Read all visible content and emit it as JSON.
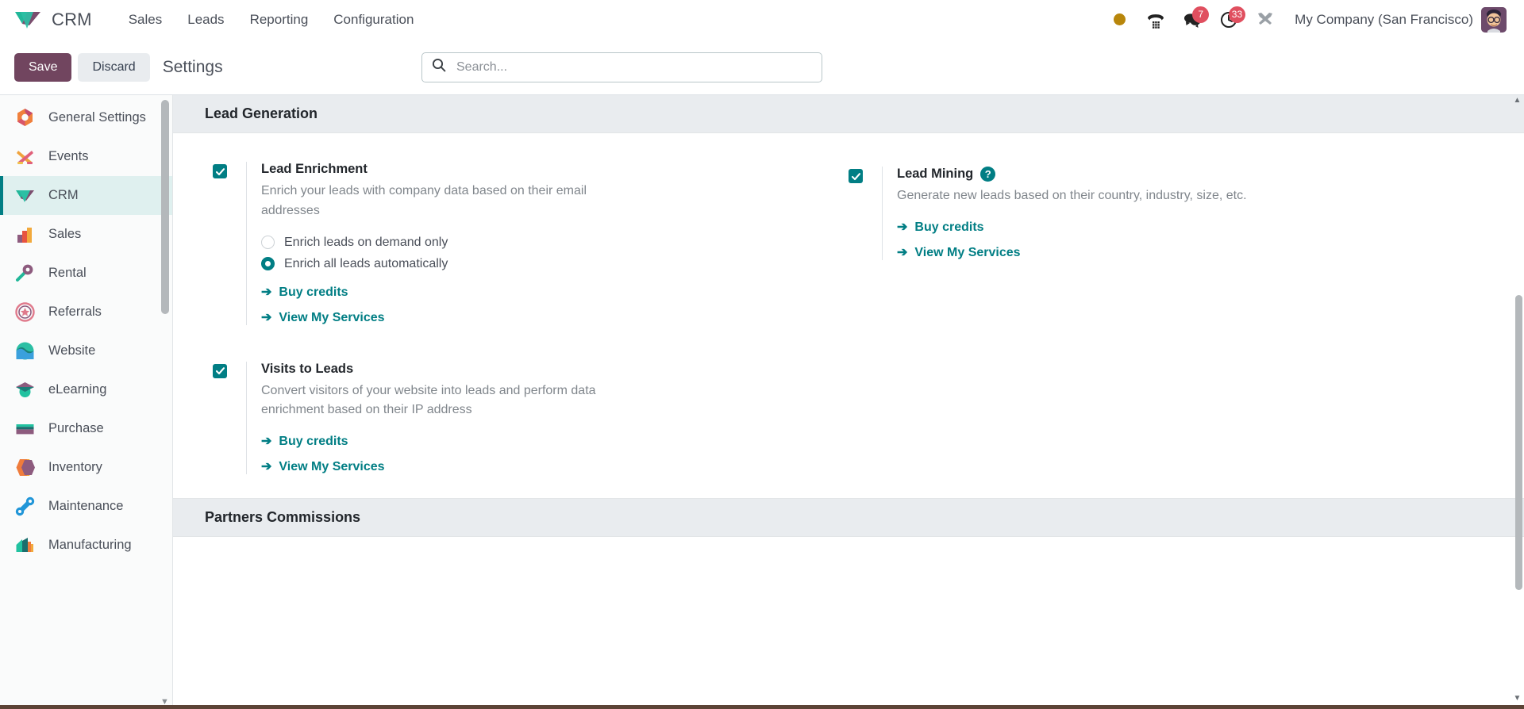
{
  "navbar": {
    "brand": "CRM",
    "menu": [
      {
        "label": "Sales"
      },
      {
        "label": "Leads"
      },
      {
        "label": "Reporting"
      },
      {
        "label": "Configuration"
      }
    ],
    "status_dot": "activity-dot",
    "icons": [
      {
        "name": "voip-phone-icon",
        "badge": ""
      },
      {
        "name": "messages-icon",
        "badge": "7"
      },
      {
        "name": "activities-clock-icon",
        "badge": "33"
      },
      {
        "name": "developer-tools-icon",
        "badge": ""
      }
    ],
    "company": "My Company (San Francisco)",
    "avatar": "user-avatar"
  },
  "control_panel": {
    "save_label": "Save",
    "discard_label": "Discard",
    "title": "Settings",
    "search_placeholder": "Search...",
    "search_value": ""
  },
  "sidebar": {
    "items": [
      {
        "label": "General Settings",
        "icon": "settings-app-icon",
        "active": false
      },
      {
        "label": "Events",
        "icon": "events-app-icon",
        "active": false
      },
      {
        "label": "CRM",
        "icon": "crm-app-icon",
        "active": true
      },
      {
        "label": "Sales",
        "icon": "sales-app-icon",
        "active": false
      },
      {
        "label": "Rental",
        "icon": "rental-app-icon",
        "active": false
      },
      {
        "label": "Referrals",
        "icon": "referrals-app-icon",
        "active": false
      },
      {
        "label": "Website",
        "icon": "website-app-icon",
        "active": false
      },
      {
        "label": "eLearning",
        "icon": "elearning-app-icon",
        "active": false
      },
      {
        "label": "Purchase",
        "icon": "purchase-app-icon",
        "active": false
      },
      {
        "label": "Inventory",
        "icon": "inventory-app-icon",
        "active": false
      },
      {
        "label": "Maintenance",
        "icon": "maintenance-app-icon",
        "active": false
      },
      {
        "label": "Manufacturing",
        "icon": "manufacturing-app-icon",
        "active": false
      }
    ]
  },
  "main": {
    "sections": [
      {
        "title": "Lead Generation",
        "settings": {
          "lead_enrichment": {
            "title": "Lead Enrichment",
            "description": "Enrich your leads with company data based on their email addresses",
            "checked": true,
            "radios": [
              {
                "label": "Enrich leads on demand only",
                "selected": false
              },
              {
                "label": "Enrich all leads automatically",
                "selected": true
              }
            ],
            "links": [
              {
                "label": "Buy credits"
              },
              {
                "label": "View My Services"
              }
            ]
          },
          "lead_mining": {
            "title": "Lead Mining",
            "description": "Generate new leads based on their country, industry, size, etc.",
            "checked": true,
            "help": "?",
            "links": [
              {
                "label": "Buy credits"
              },
              {
                "label": "View My Services"
              }
            ]
          },
          "visits_to_leads": {
            "title": "Visits to Leads",
            "description": "Convert visitors of your website into leads and perform data enrichment based on their IP address",
            "checked": true,
            "links": [
              {
                "label": "Buy credits"
              },
              {
                "label": "View My Services"
              }
            ]
          }
        }
      },
      {
        "title": "Partners Commissions"
      }
    ]
  },
  "colors": {
    "primary": "#017e84",
    "save_button": "#71455f",
    "badge": "#e04f5f",
    "section_header_bg": "#e9ecef"
  }
}
